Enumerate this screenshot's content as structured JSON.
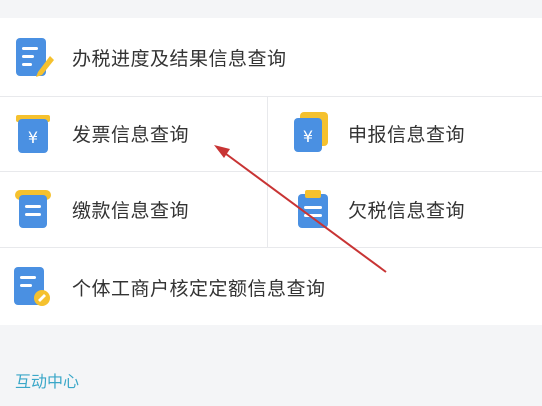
{
  "menu": {
    "tax_progress": {
      "label": "办税进度及结果信息查询",
      "icon": "document-pencil-icon"
    },
    "invoice": {
      "label": "发票信息查询",
      "icon": "invoice-yuan-icon"
    },
    "declaration": {
      "label": "申报信息查询",
      "icon": "declaration-yuan-icon"
    },
    "payment": {
      "label": "缴款信息查询",
      "icon": "payment-receipt-icon"
    },
    "arrears": {
      "label": "欠税信息查询",
      "icon": "clipboard-icon"
    },
    "individual_business": {
      "label": "个体工商户核定定额信息查询",
      "icon": "document-badge-icon"
    }
  },
  "section": {
    "interaction_center": "互动中心"
  },
  "colors": {
    "icon_blue": "#4a90e2",
    "icon_yellow": "#f5c12e",
    "section_title": "#3aa7c8",
    "annotation_arrow": "#c83434"
  }
}
